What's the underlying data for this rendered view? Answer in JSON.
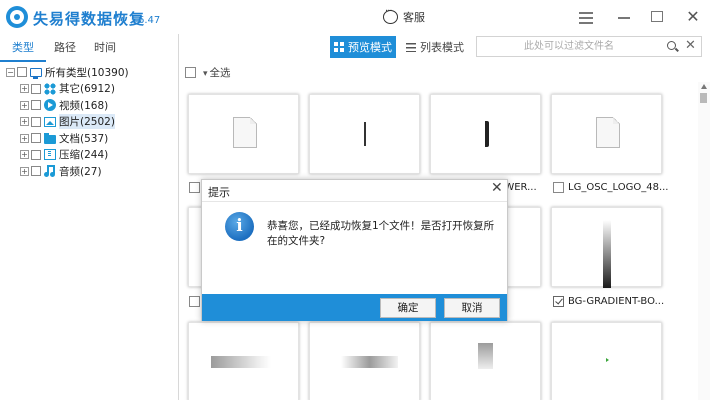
{
  "app": {
    "title": "失易得数据恢复",
    "version": "6.47",
    "support": "客服"
  },
  "left_tabs": [
    "类型",
    "路径",
    "时间"
  ],
  "tree": {
    "root": "所有类型(10390)",
    "items": [
      {
        "label": "其它(6912)",
        "icon": "grid-icon"
      },
      {
        "label": "视频(168)",
        "icon": "video-icon"
      },
      {
        "label": "图片(2502)",
        "icon": "image-icon"
      },
      {
        "label": "文档(537)",
        "icon": "folder-icon"
      },
      {
        "label": "压缩(244)",
        "icon": "archive-icon"
      },
      {
        "label": "音频(27)",
        "icon": "audio-icon"
      }
    ]
  },
  "toolbar": {
    "preview_mode": "预览模式",
    "list_mode": "列表模式",
    "search_placeholder": "此处可以过滤文件名"
  },
  "select_all": "全选",
  "files": [
    {
      "name": "",
      "checked": false
    },
    {
      "name": "",
      "checked": false
    },
    {
      "name": "EWER...",
      "checked": false
    },
    {
      "name": "LG_OSC_LOGO_48...",
      "checked": false
    },
    {
      "name": "",
      "checked": false
    },
    {
      "name": "",
      "checked": false
    },
    {
      "name": "",
      "checked": false
    },
    {
      "name": "BG-GRADIENT-BO...",
      "checked": true
    }
  ],
  "dialog": {
    "title": "提示",
    "message": "恭喜您，已经成功恢复1个文件！是否打开恢复所在的文件夹?",
    "confirm": "确定",
    "cancel": "取消"
  },
  "colors": {
    "accent": "#1f8ed8",
    "title_blue": "#1f7fcf"
  }
}
